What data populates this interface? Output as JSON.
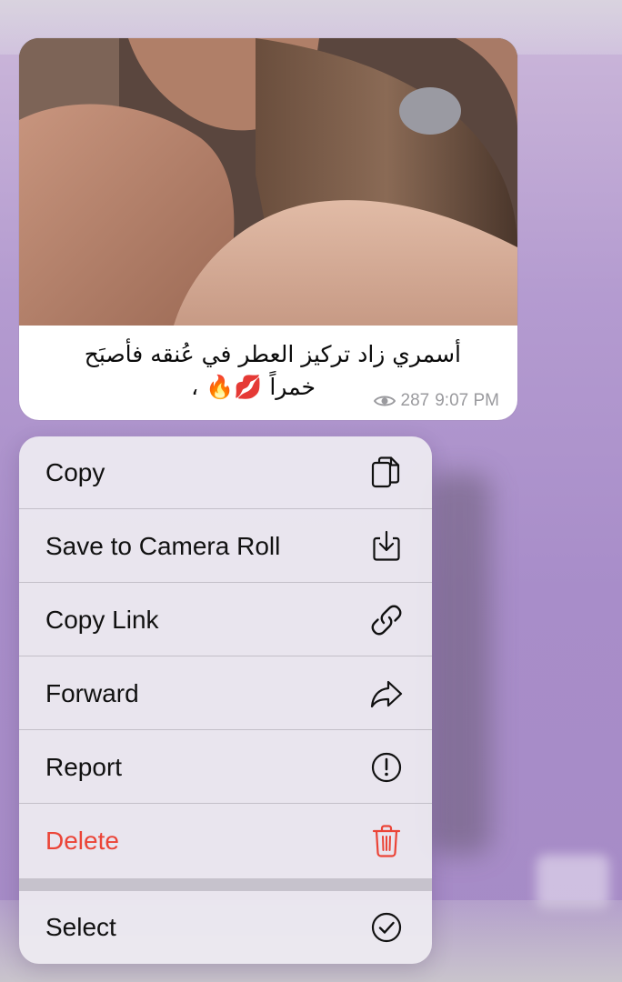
{
  "message": {
    "caption_line1": "أسمري زاد تركيز العطر في عُنقه فأصبَح",
    "caption_line2": "خمراً 💋🔥 ،",
    "views": "287",
    "time": "9:07 PM"
  },
  "context_menu": {
    "items": [
      {
        "label": "Copy",
        "icon": "copy-icon"
      },
      {
        "label": "Save to Camera Roll",
        "icon": "download-icon"
      },
      {
        "label": "Copy Link",
        "icon": "link-icon"
      },
      {
        "label": "Forward",
        "icon": "forward-arrow-icon"
      },
      {
        "label": "Report",
        "icon": "exclamation-circle-icon"
      },
      {
        "label": "Delete",
        "icon": "trash-icon"
      },
      {
        "label": "Select",
        "icon": "checkmark-circle-icon"
      }
    ]
  },
  "colors": {
    "danger": "#eb4437",
    "text": "#111111",
    "meta": "#9a9a9e"
  }
}
